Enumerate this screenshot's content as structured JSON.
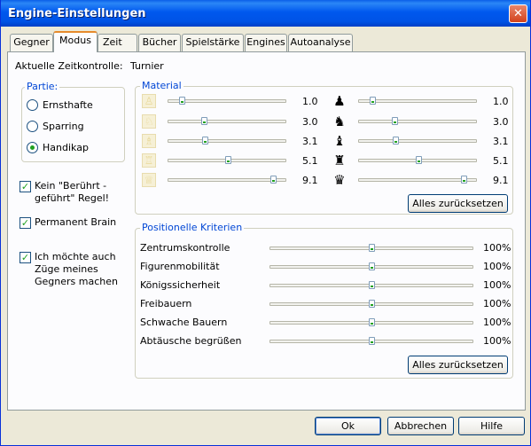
{
  "window": {
    "title": "Engine-Einstellungen",
    "close_label": "✕"
  },
  "tabs": [
    {
      "label": "Gegner"
    },
    {
      "label": "Modus"
    },
    {
      "label": "Zeit"
    },
    {
      "label": "Bücher"
    },
    {
      "label": "Spielstärke"
    },
    {
      "label": "Engines"
    },
    {
      "label": "Autoanalyse"
    }
  ],
  "zeit": {
    "label": "Aktuelle Zeitkontrolle:",
    "value": "Turnier"
  },
  "partie": {
    "legend": "Partie:",
    "options": [
      {
        "label": "Ernsthafte",
        "selected": false
      },
      {
        "label": "Sparring",
        "selected": false
      },
      {
        "label": "Handikap",
        "selected": true
      }
    ]
  },
  "checkboxes": {
    "kein_beruehrt": {
      "line1": "Kein \"Berührt -",
      "line2": "geführt\" Regel!",
      "checked": true
    },
    "permanent_brain": {
      "label": "Permanent Brain",
      "checked": true
    },
    "gegner_zuege": {
      "line1": "Ich möchte auch",
      "line2": "Züge meines",
      "line3": "Gegners machen",
      "checked": true
    }
  },
  "material": {
    "legend": "Material",
    "left": [
      {
        "icon": "pawn-icon",
        "glyph": "♙",
        "value": "1.0",
        "level": 0.1
      },
      {
        "icon": "knight-icon",
        "glyph": "♘",
        "value": "3.0",
        "level": 0.3
      },
      {
        "icon": "bishop-icon",
        "glyph": "♗",
        "value": "3.1",
        "level": 0.31
      },
      {
        "icon": "rook-icon",
        "glyph": "♖",
        "value": "5.1",
        "level": 0.51
      },
      {
        "icon": "queen-icon",
        "glyph": "♕",
        "value": "9.1",
        "level": 0.91
      }
    ],
    "right": [
      {
        "icon": "pawn-icon",
        "glyph": "♟",
        "value": "1.0",
        "level": 0.1
      },
      {
        "icon": "knight-icon",
        "glyph": "♞",
        "value": "3.0",
        "level": 0.3
      },
      {
        "icon": "bishop-icon",
        "glyph": "♝",
        "value": "3.1",
        "level": 0.31
      },
      {
        "icon": "rook-icon",
        "glyph": "♜",
        "value": "5.1",
        "level": 0.51
      },
      {
        "icon": "queen-icon",
        "glyph": "♛",
        "value": "9.1",
        "level": 0.91
      }
    ],
    "reset_label": "Alles zurücksetzen"
  },
  "positionell": {
    "legend": "Positionelle Kriterien",
    "rows": [
      {
        "label": "Zentrumskontrolle",
        "value": "100%",
        "level": 0.5
      },
      {
        "label": "Figurenmobilität",
        "value": "100%",
        "level": 0.5
      },
      {
        "label": "Königssicherheit",
        "value": "100%",
        "level": 0.5
      },
      {
        "label": "Freibauern",
        "value": "100%",
        "level": 0.5
      },
      {
        "label": "Schwache Bauern",
        "value": "100%",
        "level": 0.5
      },
      {
        "label": "Abtäusche begrüßen",
        "value": "100%",
        "level": 0.5
      }
    ],
    "reset_label": "Alles zurücksetzen"
  },
  "footer": {
    "ok_label": "Ok",
    "cancel_label": "Abbrechen",
    "help_label": "Hilfe"
  },
  "colors": {
    "titlebar": "#0058ee",
    "accent": "#0046d5",
    "check": "#21a121"
  }
}
